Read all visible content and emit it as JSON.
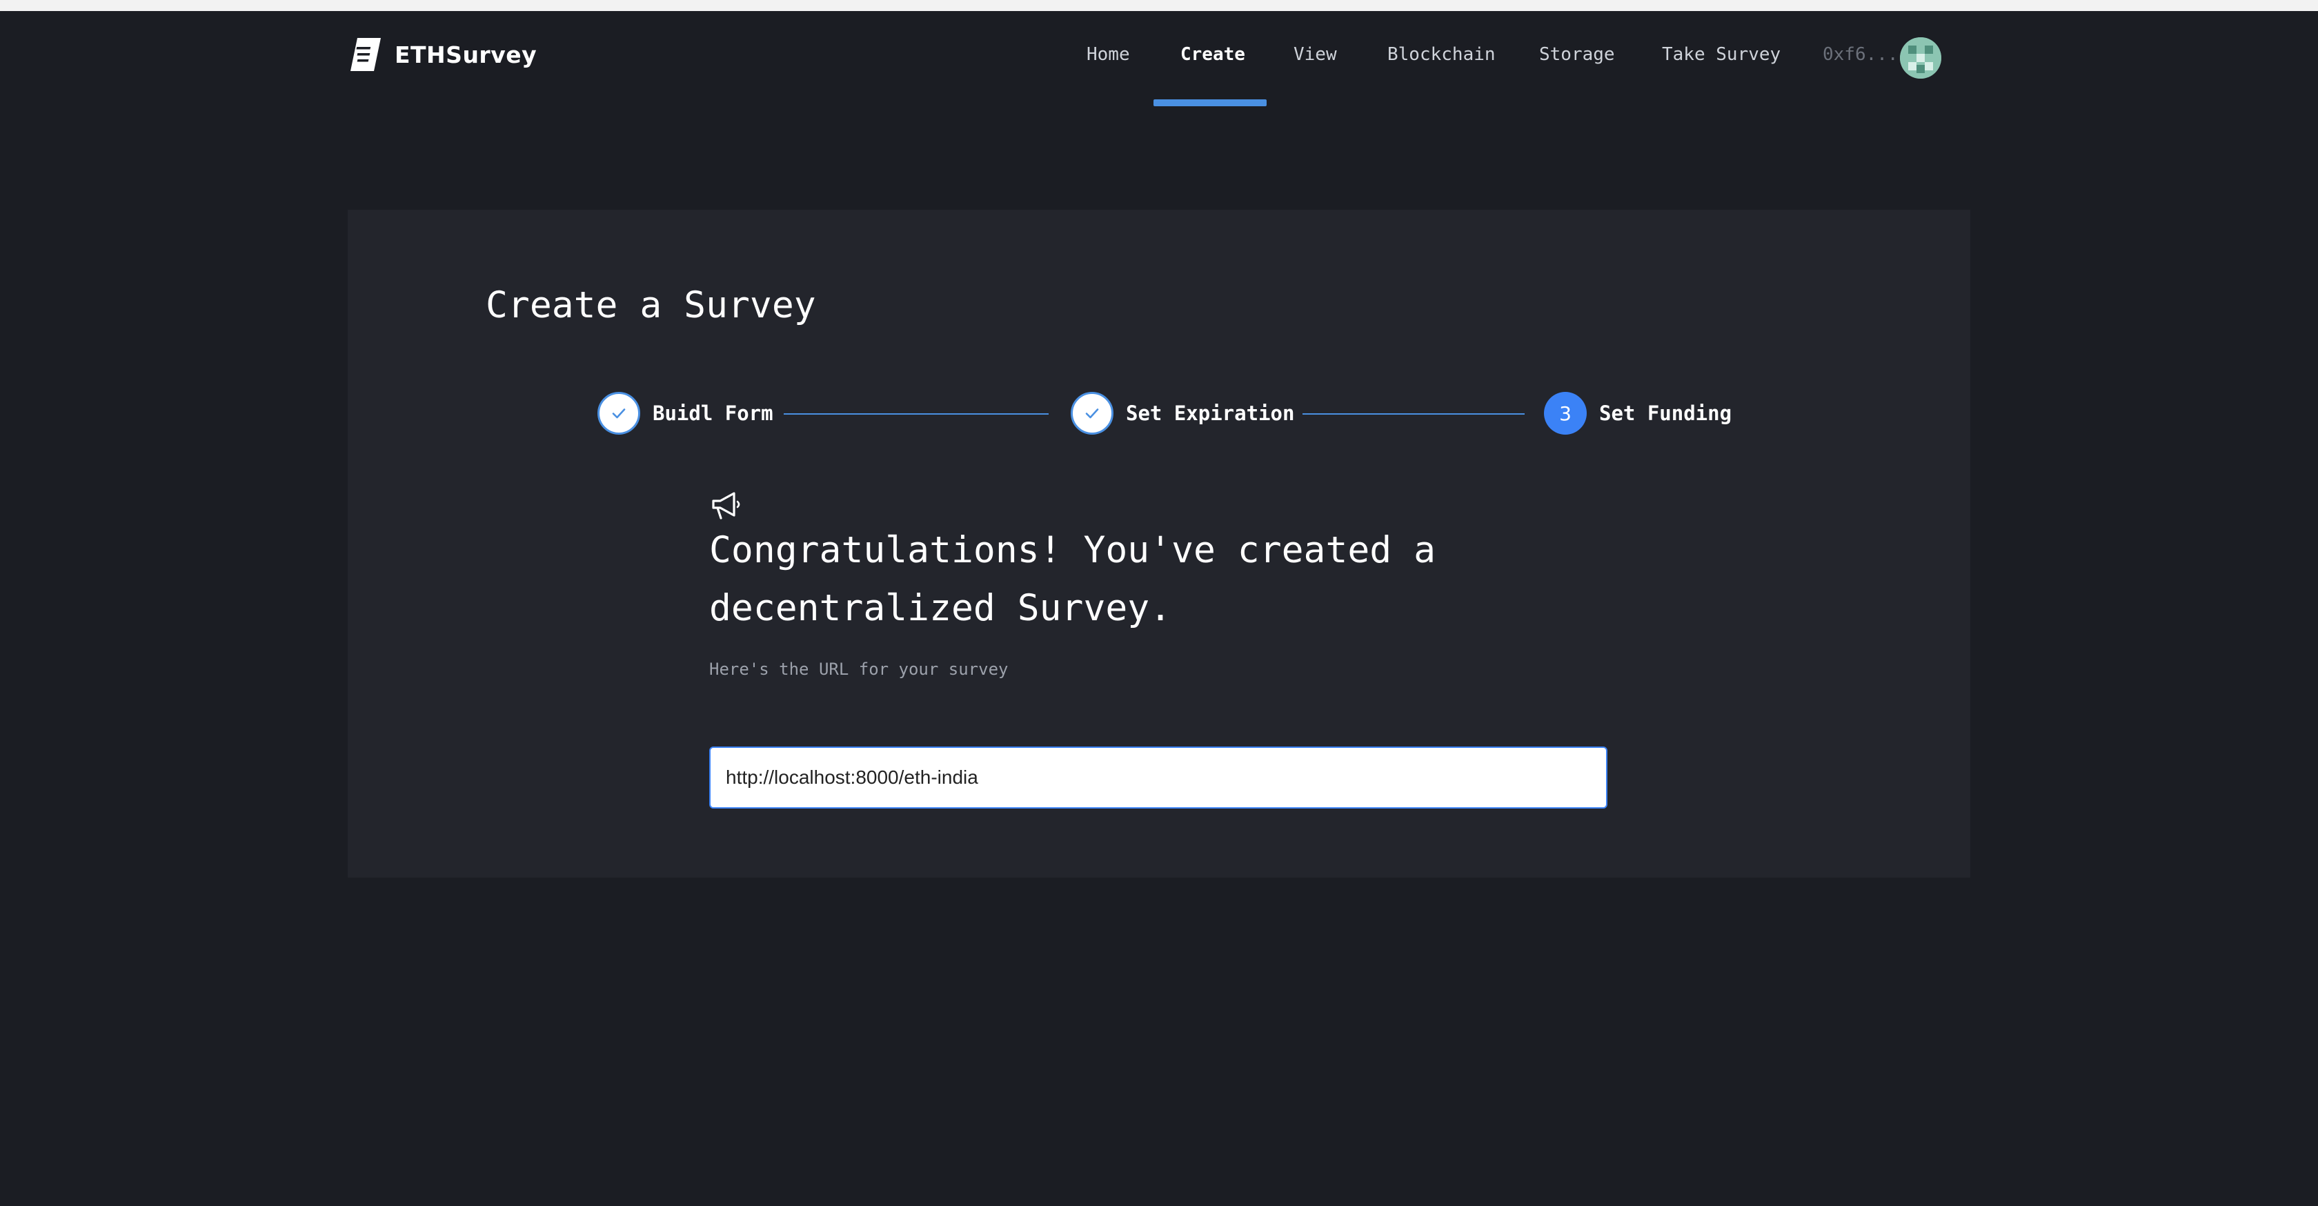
{
  "brand": {
    "name": "ETHSurvey",
    "icon": "document-icon"
  },
  "nav": {
    "items": [
      {
        "label": "Home"
      },
      {
        "label": "Create"
      },
      {
        "label": "View"
      },
      {
        "label": "Blockchain"
      },
      {
        "label": "Storage"
      },
      {
        "label": "Take Survey"
      }
    ],
    "active": "Create",
    "account": "0xf6..."
  },
  "page": {
    "title": "Create a Survey"
  },
  "steps": [
    {
      "label": "Buidl Form",
      "status": "complete",
      "icon": "check-icon"
    },
    {
      "label": "Set Expiration",
      "status": "complete",
      "icon": "check-icon"
    },
    {
      "number": "3",
      "label": "Set Funding",
      "status": "current"
    }
  ],
  "result": {
    "icon": "megaphone-icon",
    "heading": "Congratulations! You've created a decentralized Survey.",
    "caption": "Here's the URL for your survey",
    "url": "http://localhost:8000/eth-india"
  },
  "colors": {
    "background": "#1b1d23",
    "card": "#23252c",
    "accent": "#3b82f6"
  }
}
